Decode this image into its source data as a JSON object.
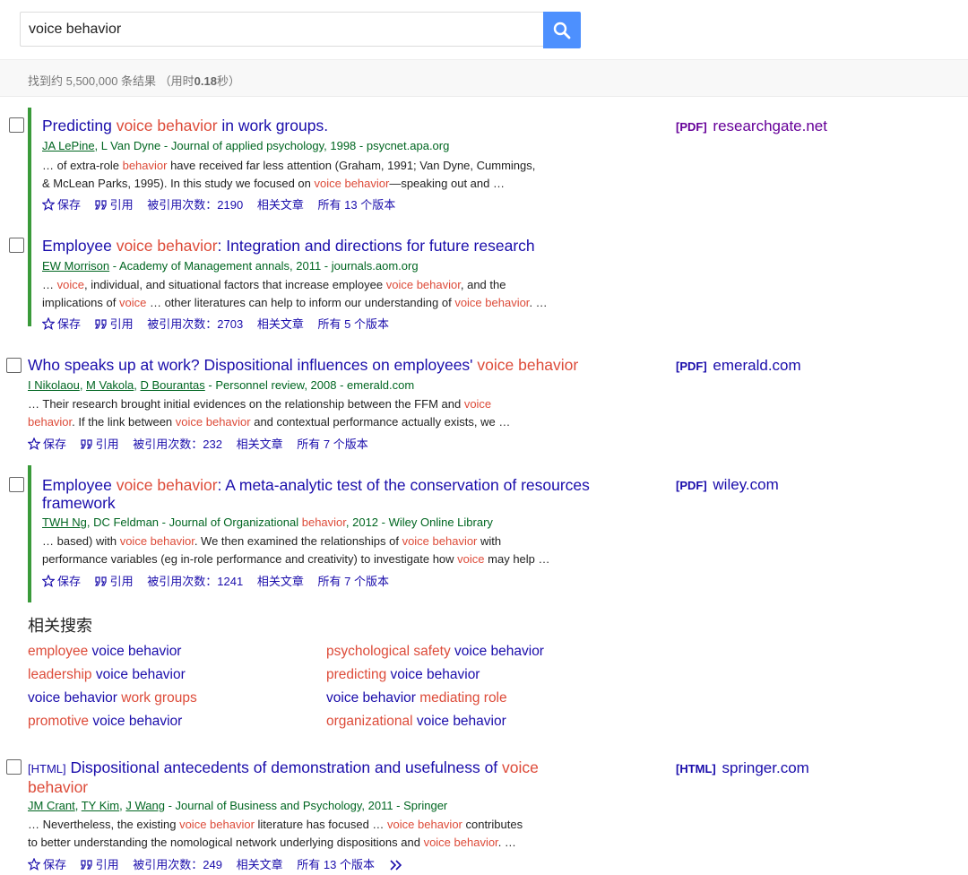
{
  "search": {
    "value": "voice behavior"
  },
  "stats": {
    "prefix": "找到约 5,500,000 条结果 （用时",
    "time": "0.18",
    "suffix": "秒）"
  },
  "actions": {
    "save": "保存",
    "cite": "引用",
    "cited_prefix": "被引用次数：",
    "related": "相关文章",
    "versions_prefix": "所有 ",
    "versions_suffix": " 个版本"
  },
  "results": [
    {
      "title": [
        "Predicting ",
        "voice behavior",
        " in work groups."
      ],
      "authors": [
        "JA LePine",
        "L Van Dyne"
      ],
      "source": " - Journal of applied psychology, 1998 - psycnet.apa.org",
      "line1": [
        "… of extra-role ",
        "behavior",
        " have received far less attention (Graham, 1991; Van Dyne, Cummings,"
      ],
      "line2": [
        "& McLean Parks, 1995). In this study we focused on ",
        "voice behavior",
        "—speaking out and …"
      ],
      "cited": "2190",
      "versions": "13",
      "side_fmt": "[PDF]",
      "side_domain": "researchgate.net"
    },
    {
      "title": [
        "Employee ",
        "voice behavior",
        ": Integration and directions for future research"
      ],
      "authors": [
        "EW Morrison"
      ],
      "source": " - Academy of Management annals, 2011 - journals.aom.org",
      "line1": [
        "… ",
        "voice",
        ", individual, and situational factors that increase employee ",
        "voice behavior",
        ", and the"
      ],
      "line2": [
        "implications of ",
        "voice",
        " … other literatures can help to inform our understanding of ",
        "voice behavior",
        ". …"
      ],
      "cited": "2703",
      "versions": "5"
    },
    {
      "title": [
        "Who speaks up at work? Dispositional influences on employees' ",
        "voice behavior"
      ],
      "authors": [
        "I Nikolaou",
        "M Vakola",
        "D Bourantas"
      ],
      "source": " - Personnel review, 2008 - emerald.com",
      "line1": [
        "… Their research brought initial evidences on the relationship between the FFM and ",
        "voice"
      ],
      "line2": [
        "behavior",
        ". If the link between ",
        "voice behavior",
        " and contextual performance actually exists, we …"
      ],
      "cited": "232",
      "versions": "7",
      "side_fmt": "[PDF]",
      "side_domain": "emerald.com"
    },
    {
      "title": [
        "Employee ",
        "voice behavior",
        ": A meta-analytic test of the conservation of resources"
      ],
      "title2": "framework",
      "authors": [
        "TWH Ng"
      ],
      "source_a": ", DC Feldman - Journal of Organizational ",
      "source_hl": "behavior",
      "source_b": ", 2012 - Wiley Online Library",
      "line1": [
        "… based) with ",
        "voice behavior",
        ". We then examined the relationships of ",
        "voice behavior",
        " with"
      ],
      "line2": [
        "performance variables (eg in-role performance and creativity) to investigate how ",
        "voice",
        " may help …"
      ],
      "cited": "1241",
      "versions": "7",
      "side_fmt": "[PDF]",
      "side_domain": "wiley.com"
    },
    {
      "tag": "[HTML]",
      "title": [
        " Dispositional antecedents of demonstration and usefulness of ",
        "voice"
      ],
      "title2": "behavior",
      "authors": [
        "JM Crant",
        "TY Kim",
        "J Wang"
      ],
      "source": " - Journal of Business and Psychology, 2011 - Springer",
      "line1": [
        "… Nevertheless, the existing ",
        "voice behavior",
        " literature has focused … ",
        "voice behavior",
        " contributes"
      ],
      "line2": [
        "to better understanding the nomological network underlying dispositions and ",
        "voice behavior",
        ". …"
      ],
      "cited": "249",
      "versions": "13",
      "side_fmt": "[HTML]",
      "side_domain": "springer.com"
    }
  ],
  "related": {
    "title": "相关搜索",
    "items": [
      [
        "employee",
        " voice behavior"
      ],
      [
        "psychological safety",
        " voice behavior"
      ],
      [
        "leadership",
        " voice behavior"
      ],
      [
        "predicting",
        " voice behavior"
      ],
      [
        "voice behavior ",
        "work groups"
      ],
      [
        "voice behavior ",
        "mediating role"
      ],
      [
        "promotive",
        " voice behavior"
      ],
      [
        "organizational",
        " voice behavior"
      ]
    ]
  },
  "colors": {
    "link": "#1a0dab",
    "highlight": "#dd4b39",
    "meta": "#006621",
    "visited": "#660099",
    "accent_bar": "#3a9a3a",
    "search_button": "#4d90fe"
  },
  "icons": [
    "search-icon",
    "star-icon",
    "quote-icon",
    "double-chevron-icon"
  ]
}
